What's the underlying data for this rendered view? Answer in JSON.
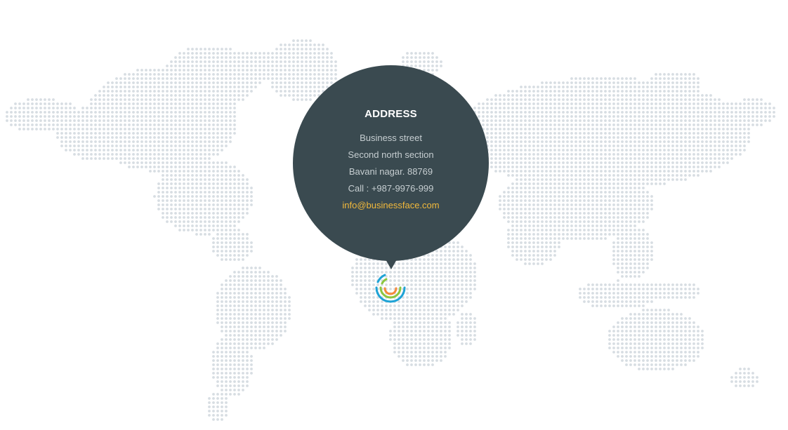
{
  "address": {
    "title": "ADDRESS",
    "line1": "Business street",
    "line2": "Second north section",
    "line3": "Bavani nagar. 88769",
    "phone": "Call : +987-9976-999",
    "email": "info@businessface.com"
  },
  "colors": {
    "bubble": "#3a4a50",
    "email": "#f2b93b",
    "map_dot": "#d7dde2",
    "marker_blue": "#1fa3d6",
    "marker_green": "#8dc63f",
    "marker_orange": "#f58a3a"
  },
  "icons": {
    "marker": "location-pulse-icon"
  }
}
